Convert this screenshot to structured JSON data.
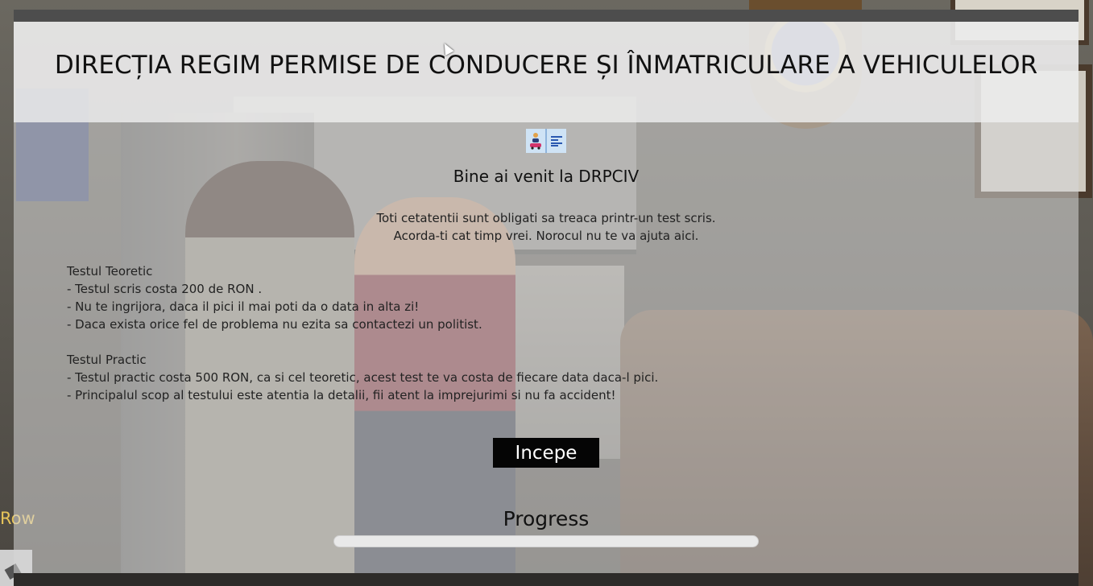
{
  "header": {
    "title": "DIRECȚIA REGIM PERMISE DE CONDUCERE ȘI ÎNMATRICULARE A VEHICULELOR"
  },
  "logo": {
    "left_icon": "person-car-icon",
    "right_icon": "align-left-icon"
  },
  "welcome": "Bine ai venit la DRPCIV",
  "intro": {
    "line1": "Toti cetatentii sunt obligati sa treaca printr-un test scris.",
    "line2": "Acorda-ti cat timp vrei. Norocul nu te va ajuta aici."
  },
  "theory": {
    "title": "Testul Teoretic",
    "items": [
      "- Testul scris costa 200 de RON .",
      "- Nu te ingrijora, daca il pici il mai poti da o data in alta zi!",
      "- Daca exista orice fel de problema nu ezita sa contactezi un politist."
    ]
  },
  "practical": {
    "title": "Testul Practic",
    "items": [
      "- Testul practic costa 500 RON, ca si cel teoretic, acest test te va costa de fiecare data daca-l pici.",
      "- Principalul scop al testului este atentia la detalii, fii atent la imprejurimi si nu fa accident!"
    ]
  },
  "start_button": "Incepe",
  "progress": {
    "label": "Progress",
    "value": 0
  },
  "hud": {
    "row_label": "Row"
  },
  "colors": {
    "button_bg": "#050505",
    "hud_text": "#e7c45a",
    "logo_bg": "#cfe3f5"
  }
}
